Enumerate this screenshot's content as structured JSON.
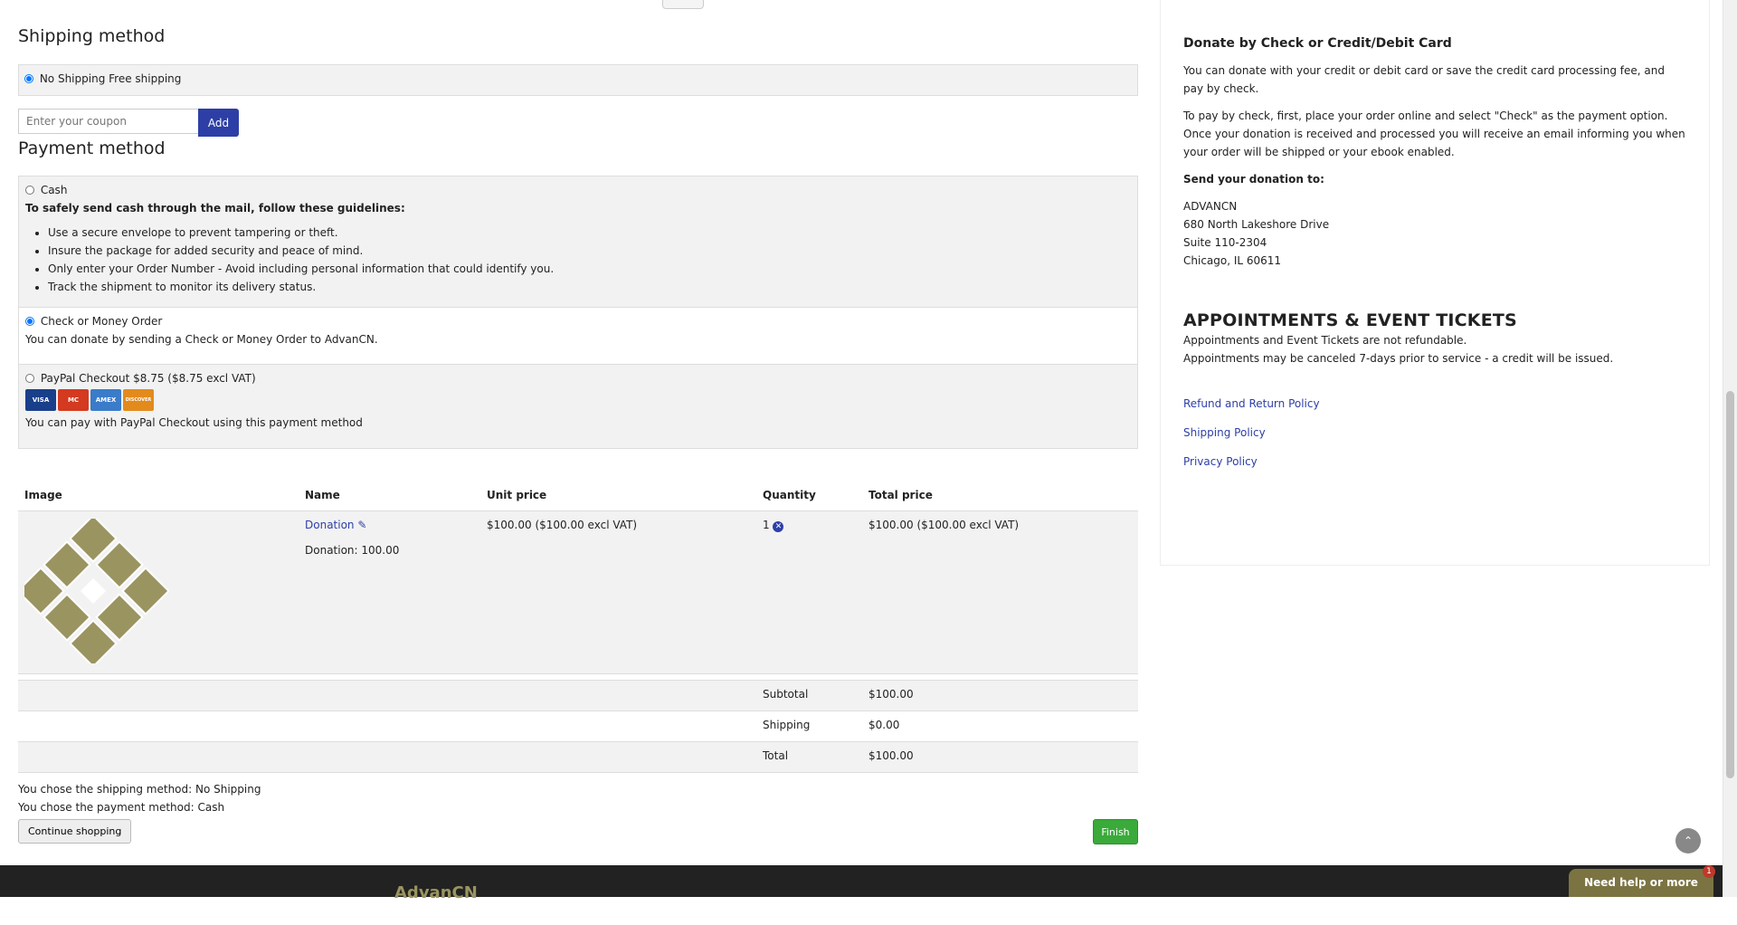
{
  "shipping": {
    "title": "Shipping method",
    "option_label": "No Shipping Free shipping"
  },
  "coupon": {
    "placeholder": "Enter your coupon",
    "add_label": "Add"
  },
  "payment": {
    "title": "Payment method",
    "cash": {
      "label": "Cash",
      "guideline_title": "To safely send cash through the mail, follow these guidelines:",
      "guidelines": [
        "Use a secure envelope to prevent tampering or theft.",
        "Insure the package for added security and peace of mind.",
        "Only enter your Order Number - Avoid including personal information that could identify you.",
        "Track the shipment to monitor its delivery status."
      ]
    },
    "check": {
      "label": "Check or Money Order",
      "description": "You can donate by sending a Check or Money Order to AdvanCN."
    },
    "paypal": {
      "label": "PayPal Checkout $8.75 ($8.75 excl VAT)",
      "cards": [
        "VISA",
        "MC",
        "AMEX",
        "DISCOVER"
      ],
      "description": "You can pay with PayPal Checkout using this payment method"
    }
  },
  "cart": {
    "headers": [
      "Image",
      "Name",
      "Unit price",
      "Quantity",
      "Total price"
    ],
    "item": {
      "name": "Donation",
      "detail": "Donation: 100.00",
      "unit_price": "$100.00 ($100.00 excl VAT)",
      "quantity": "1",
      "total_price": "$100.00 ($100.00 excl VAT)"
    },
    "subtotal_label": "Subtotal",
    "subtotal_value": "$100.00",
    "shipping_label": "Shipping",
    "shipping_value": "$0.00",
    "total_label": "Total",
    "total_value": "$100.00"
  },
  "summary": {
    "shipping_chosen": "You chose the shipping method: No Shipping",
    "payment_chosen": "You chose the payment method: Cash"
  },
  "buttons": {
    "continue": "Continue shopping",
    "finish": "Finish"
  },
  "sidebar": {
    "donate_title": "Donate by Check or Credit/Debit Card",
    "donate_p1": "You can donate with your credit or debit card or save the credit card processing fee, and pay by check.",
    "donate_p2": "To pay by check, first, place your order online and select \"Check\" as the payment option. Once your donation is received and processed you will receive an email informing you when your order will be shipped or your ebook enabled.",
    "send_title": "Send your donation to:",
    "address": [
      "ADVANCN",
      "680 North Lakeshore Drive",
      "Suite 110-2304",
      "Chicago, IL 60611"
    ],
    "appt_title": "APPOINTMENTS & EVENT TICKETS",
    "appt_l1": "Appointments and Event Tickets are not refundable.",
    "appt_l2": "Appointments may be canceled 7-days prior to service - a credit will be issued.",
    "links": [
      "Refund and Return Policy",
      "Shipping Policy",
      "Privacy Policy"
    ]
  },
  "footer": {
    "brand": "AdvanCN"
  },
  "help": {
    "label": "Need help or more inf...",
    "badge": "1"
  },
  "colors": {
    "accent": "#2d3fa6",
    "finish": "#3aaa3a",
    "logo": "#9a9461"
  }
}
